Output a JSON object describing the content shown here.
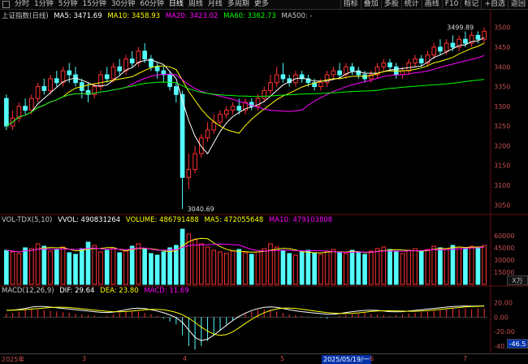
{
  "toolbar": {
    "tabs": [
      "分时",
      "1分钟",
      "5分钟",
      "15分钟",
      "30分钟",
      "60分钟",
      "日线",
      "周线",
      "月线",
      "多周期",
      "更多"
    ],
    "active_tab": "日线",
    "right_items": [
      "指标",
      "叠加",
      "多股",
      "统计",
      "画线",
      "F10",
      "标记",
      "+自选",
      "返回"
    ]
  },
  "price_legend": {
    "title": "上证指数(日线)",
    "ma5": "MA5: 3471.69",
    "ma10": "MA10: 3458.93",
    "ma20": "MA20: 3423.02",
    "ma60": "MA60: 3362.73",
    "ma500": "MA500: -"
  },
  "price_axis": [
    "3500",
    "3450",
    "3400",
    "3350",
    "3300",
    "3250",
    "3200",
    "3150",
    "3100",
    "3050"
  ],
  "price_annotations": {
    "high": "3499.89",
    "low": "3040.69"
  },
  "vol_legend": {
    "title": "VOL-TDX(5,10)",
    "vvol": "VVOL: 490831264",
    "volume": "VOLUME: 486791488",
    "ma5": "MA5: 472055648",
    "ma10": "MA10: 479103808"
  },
  "vol_axis": [
    "60000",
    "45000",
    "30000",
    "15000"
  ],
  "vol_unit": "X万",
  "macd_legend": {
    "title": "MACD(12,26,9)",
    "dif": "DIF: 29.64",
    "dea": "DEA: 23.80",
    "macd": "MACD: 11.69"
  },
  "macd_axis": [
    "20.00",
    "0.00",
    "-20.00",
    "-40.00"
  ],
  "macd_badge": "-46.5",
  "side_label": "日线",
  "dates": {
    "start": "2025年",
    "m3": "3",
    "m4": "4",
    "m5": "5",
    "highlight": "2025/05/19/一",
    "m6": "6",
    "m7": "7"
  },
  "colors": {
    "up": "#ff3232",
    "down": "#54fcfc",
    "ma5": "#ffffff",
    "ma10": "#ffff00",
    "ma20": "#ff00ff",
    "ma60": "#00ff00"
  },
  "chart_data": {
    "type": "candlestick",
    "ylim": [
      3030,
      3520
    ],
    "candles": [
      [
        3320,
        3250,
        3330,
        3240
      ],
      [
        3250,
        3270,
        3290,
        3240
      ],
      [
        3270,
        3300,
        3310,
        3260
      ],
      [
        3300,
        3290,
        3320,
        3280
      ],
      [
        3290,
        3320,
        3330,
        3280
      ],
      [
        3320,
        3350,
        3360,
        3310
      ],
      [
        3350,
        3340,
        3370,
        3330
      ],
      [
        3340,
        3370,
        3380,
        3330
      ],
      [
        3370,
        3360,
        3390,
        3350
      ],
      [
        3360,
        3390,
        3400,
        3350
      ],
      [
        3390,
        3380,
        3410,
        3360
      ],
      [
        3380,
        3360,
        3400,
        3350
      ],
      [
        3360,
        3340,
        3370,
        3320
      ],
      [
        3340,
        3330,
        3360,
        3310
      ],
      [
        3330,
        3350,
        3360,
        3320
      ],
      [
        3350,
        3380,
        3390,
        3340
      ],
      [
        3380,
        3370,
        3400,
        3360
      ],
      [
        3370,
        3400,
        3410,
        3360
      ],
      [
        3400,
        3390,
        3420,
        3380
      ],
      [
        3390,
        3420,
        3430,
        3380
      ],
      [
        3420,
        3410,
        3440,
        3400
      ],
      [
        3410,
        3440,
        3450,
        3400
      ],
      [
        3440,
        3420,
        3460,
        3410
      ],
      [
        3420,
        3400,
        3430,
        3390
      ],
      [
        3400,
        3390,
        3410,
        3370
      ],
      [
        3390,
        3380,
        3400,
        3360
      ],
      [
        3380,
        3350,
        3390,
        3340
      ],
      [
        3350,
        3330,
        3360,
        3310
      ],
      [
        3330,
        3120,
        3340,
        3040
      ],
      [
        3120,
        3140,
        3180,
        3090
      ],
      [
        3140,
        3180,
        3200,
        3130
      ],
      [
        3180,
        3220,
        3230,
        3170
      ],
      [
        3220,
        3240,
        3260,
        3210
      ],
      [
        3240,
        3260,
        3280,
        3230
      ],
      [
        3260,
        3280,
        3290,
        3250
      ],
      [
        3280,
        3290,
        3300,
        3270
      ],
      [
        3290,
        3300,
        3310,
        3280
      ],
      [
        3300,
        3290,
        3320,
        3280
      ],
      [
        3290,
        3310,
        3320,
        3280
      ],
      [
        3310,
        3300,
        3320,
        3290
      ],
      [
        3300,
        3320,
        3330,
        3290
      ],
      [
        3320,
        3340,
        3350,
        3310
      ],
      [
        3340,
        3360,
        3380,
        3330
      ],
      [
        3360,
        3380,
        3400,
        3350
      ],
      [
        3380,
        3370,
        3410,
        3360
      ],
      [
        3370,
        3360,
        3380,
        3350
      ],
      [
        3360,
        3380,
        3390,
        3350
      ],
      [
        3380,
        3370,
        3390,
        3360
      ],
      [
        3370,
        3360,
        3380,
        3350
      ],
      [
        3360,
        3350,
        3370,
        3340
      ],
      [
        3350,
        3360,
        3370,
        3340
      ],
      [
        3360,
        3380,
        3390,
        3350
      ],
      [
        3380,
        3390,
        3400,
        3370
      ],
      [
        3390,
        3380,
        3410,
        3370
      ],
      [
        3380,
        3400,
        3410,
        3370
      ],
      [
        3400,
        3390,
        3410,
        3380
      ],
      [
        3390,
        3380,
        3400,
        3370
      ],
      [
        3380,
        3370,
        3390,
        3360
      ],
      [
        3370,
        3380,
        3390,
        3360
      ],
      [
        3380,
        3400,
        3410,
        3370
      ],
      [
        3400,
        3410,
        3420,
        3390
      ],
      [
        3410,
        3400,
        3420,
        3390
      ],
      [
        3400,
        3380,
        3410,
        3370
      ],
      [
        3380,
        3390,
        3400,
        3370
      ],
      [
        3390,
        3410,
        3420,
        3380
      ],
      [
        3410,
        3420,
        3430,
        3400
      ],
      [
        3420,
        3410,
        3430,
        3400
      ],
      [
        3410,
        3430,
        3440,
        3400
      ],
      [
        3430,
        3450,
        3460,
        3420
      ],
      [
        3450,
        3440,
        3470,
        3430
      ],
      [
        3440,
        3460,
        3470,
        3430
      ],
      [
        3460,
        3450,
        3480,
        3440
      ],
      [
        3450,
        3470,
        3480,
        3440
      ],
      [
        3470,
        3460,
        3490,
        3450
      ],
      [
        3460,
        3480,
        3490,
        3450
      ],
      [
        3480,
        3470,
        3490,
        3460
      ],
      [
        3470,
        3490,
        3500,
        3460
      ]
    ],
    "volume_ylim": [
      0,
      70000
    ],
    "volume": [
      42000,
      40000,
      38000,
      45000,
      44000,
      50000,
      47000,
      41000,
      43000,
      46000,
      39000,
      37000,
      44000,
      52000,
      48000,
      40000,
      42000,
      45000,
      39000,
      41000,
      47000,
      50000,
      43000,
      38000,
      36000,
      40000,
      45000,
      48000,
      68000,
      62000,
      55000,
      50000,
      46000,
      42000,
      40000,
      38000,
      41000,
      43000,
      39000,
      37000,
      40000,
      44000,
      50000,
      46000,
      42000,
      38000,
      36000,
      40000,
      42000,
      39000,
      37000,
      41000,
      43000,
      40000,
      38000,
      42000,
      39000,
      37000,
      41000,
      44000,
      46000,
      43000,
      40000,
      38000,
      42000,
      44000,
      41000,
      43000,
      47000,
      45000,
      44000,
      48000,
      46000,
      44000,
      47000,
      45000,
      48000
    ],
    "macd_ylim": [
      -48,
      32
    ],
    "macd": [
      5,
      6,
      8,
      10,
      12,
      11,
      10,
      9,
      8,
      7,
      6,
      5,
      4,
      3,
      2,
      1,
      2,
      4,
      6,
      8,
      9,
      8,
      6,
      4,
      2,
      -2,
      -6,
      -10,
      -25,
      -40,
      -45,
      -40,
      -33,
      -26,
      -18,
      -10,
      -4,
      1,
      5,
      8,
      10,
      11,
      10,
      8,
      6,
      4,
      3,
      2,
      1,
      0,
      -1,
      -2,
      0,
      2,
      3,
      4,
      5,
      6,
      5,
      4,
      3,
      2,
      3,
      4,
      5,
      6,
      7,
      8,
      9,
      10,
      11,
      12,
      11,
      12,
      11,
      12,
      12
    ]
  }
}
